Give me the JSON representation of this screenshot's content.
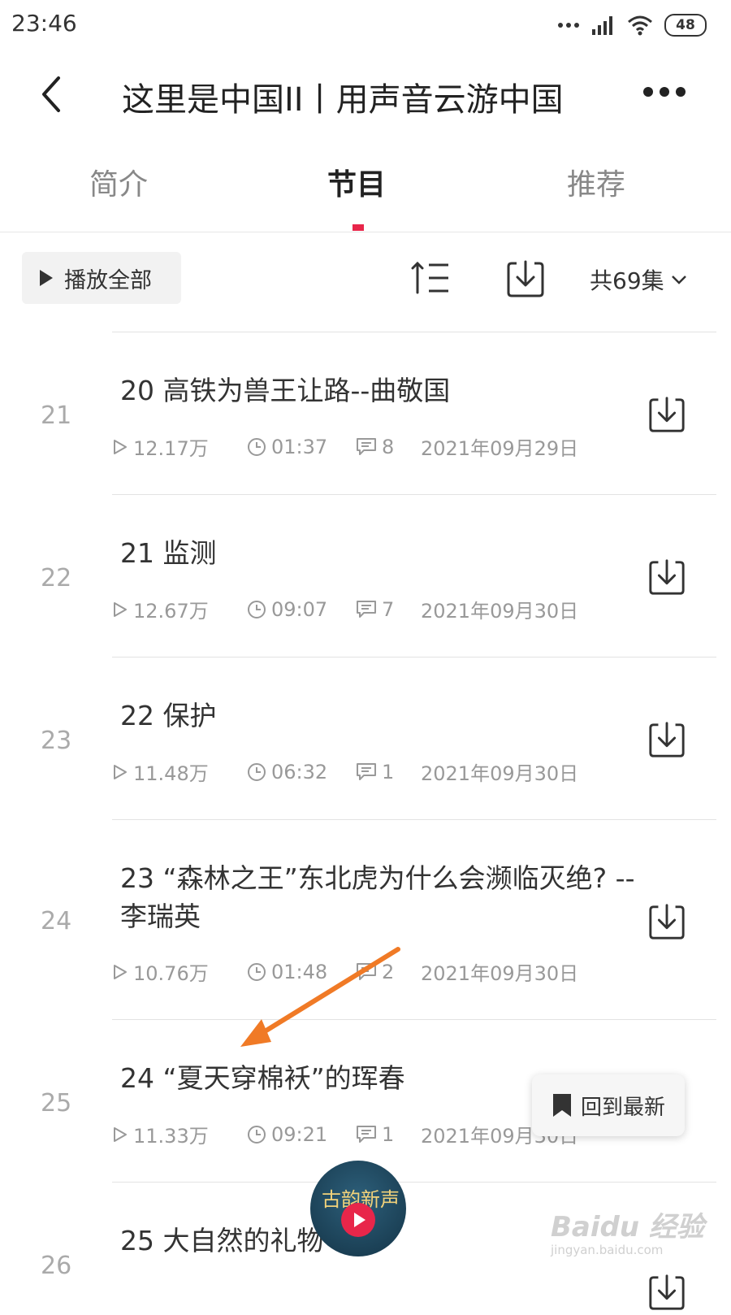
{
  "status": {
    "time": "23:46",
    "battery": "48"
  },
  "header": {
    "title": "这里是中国II丨用声音云游中国",
    "back_icon": "chevron-left-icon",
    "more_icon": "more-dots-icon"
  },
  "tabs": [
    {
      "label": "简介",
      "active": false
    },
    {
      "label": "节目",
      "active": true
    },
    {
      "label": "推荐",
      "active": false
    }
  ],
  "accent_color": "#e8264a",
  "toolbar": {
    "play_all": "播放全部",
    "episode_count": "共69集"
  },
  "episodes": [
    {
      "index": "21",
      "title": "20 高铁为兽王让路--曲敬国",
      "plays": "12.17万",
      "duration": "01:37",
      "comments": "8",
      "date": "2021年09月29日"
    },
    {
      "index": "22",
      "title": "21 监测",
      "plays": "12.67万",
      "duration": "09:07",
      "comments": "7",
      "date": "2021年09月30日"
    },
    {
      "index": "23",
      "title": "22 保护",
      "plays": "11.48万",
      "duration": "06:32",
      "comments": "1",
      "date": "2021年09月30日"
    },
    {
      "index": "24",
      "title": "23 “森林之王”东北虎为什么会濒临灭绝? --李瑞英",
      "plays": "10.76万",
      "duration": "01:48",
      "comments": "2",
      "date": "2021年09月30日"
    },
    {
      "index": "25",
      "title": "24 “夏天穿棉袄”的珲春",
      "plays": "11.33万",
      "duration": "09:21",
      "comments": "1",
      "date": "2021年09月30日"
    },
    {
      "index": "26",
      "title": "25 大自然的礼物"
    }
  ],
  "floating": {
    "back_to_latest": "回到最新",
    "disc_text": "古韵新声"
  },
  "watermark": {
    "brand": "Baidu 经验",
    "url": "jingyan.baidu.com"
  }
}
